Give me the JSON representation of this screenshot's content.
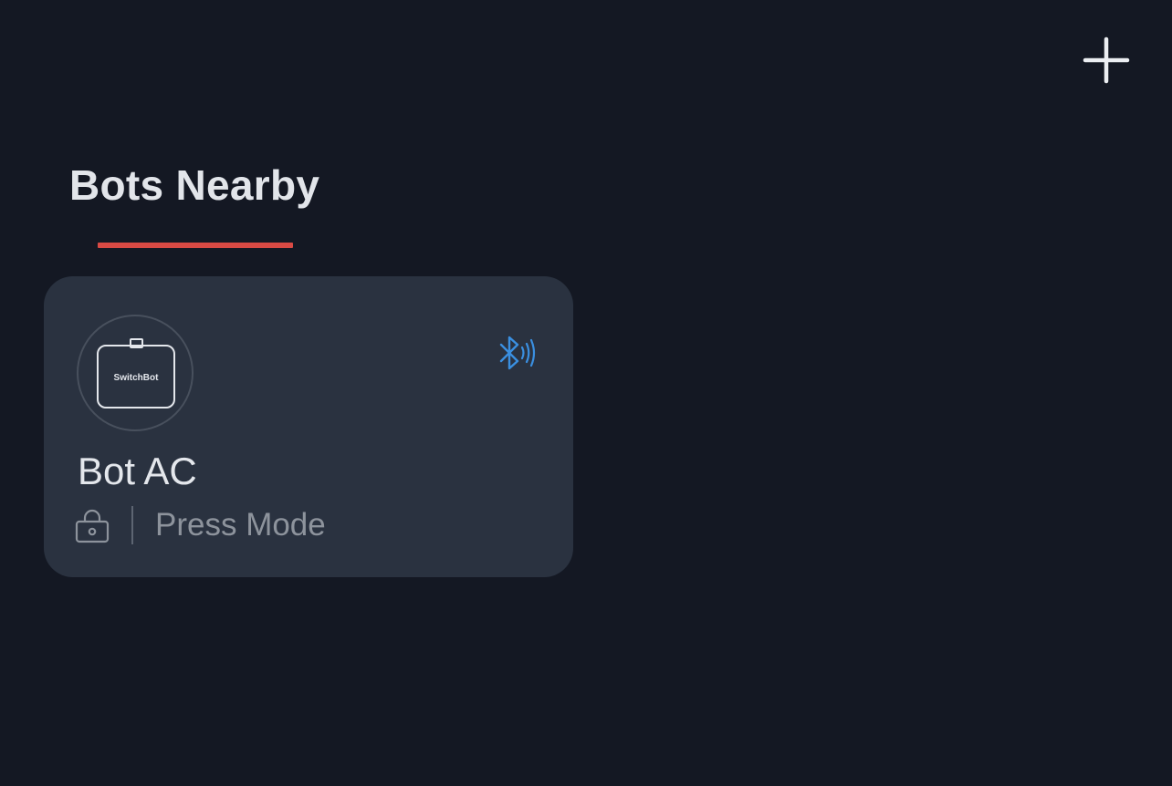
{
  "header": {
    "add_icon": "plus-icon"
  },
  "tabs": [
    {
      "label": "Bots Nearby",
      "active": true
    }
  ],
  "colors": {
    "background": "#141823",
    "card": "#2a3240",
    "accent_underline": "#d94a44",
    "bluetooth": "#3a8fe0"
  },
  "device": {
    "name": "Bot AC",
    "mode": "Press Mode",
    "device_logo_text": "SwitchBot",
    "connection_icon": "bluetooth-icon",
    "lock_icon": "lock-icon"
  }
}
